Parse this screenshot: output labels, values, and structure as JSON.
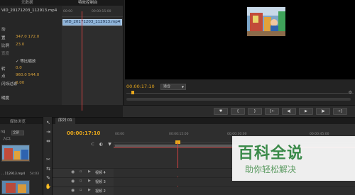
{
  "effect_controls": {
    "tab_labels": [
      "元数据",
      "特效控制台"
    ],
    "clip_name": "VID_20171203_112913.mp4",
    "properties": [
      {
        "label": "动",
        "value": ""
      },
      {
        "label": "置",
        "value": "347.0    172.0"
      },
      {
        "label": "比例",
        "value": "23.0"
      },
      {
        "label": "宽度",
        "value": ""
      },
      {
        "label": "等比缩放",
        "value": ""
      },
      {
        "label": "转",
        "value": "0.0"
      },
      {
        "label": "点",
        "value": "960.0    544.0"
      },
      {
        "label": "闪烁过滤",
        "value": "0.00"
      },
      {
        "label": "明度",
        "value": ""
      }
    ],
    "ruler_times": [
      "00:00",
      "00:00:15:00"
    ],
    "timeline_clip": "VID_20171203_112913.mp4"
  },
  "program_monitor": {
    "timecode": "00:00:17:10",
    "fit": "适合",
    "transport_buttons": [
      "♥",
      "{",
      "}",
      "{←",
      "◀|",
      "▶",
      "|▶",
      "→}"
    ]
  },
  "project_panel": {
    "tab": "媒体浏览",
    "filter_left": "roj",
    "filter_label": "入口:",
    "filter_value": "全部",
    "items": [
      {
        "name": "…112913.mp4",
        "duration": "54:03"
      },
      {
        "name": "",
        "duration": ""
      }
    ]
  },
  "tools": [
    "↖",
    "⇥",
    "⇹",
    "✂",
    "⇆",
    "✎",
    "✋",
    "🔍"
  ],
  "sequence": {
    "tab": "序列 01",
    "timecode": "00:00:17:10",
    "ruler": [
      "00:00",
      "00:00:15:00",
      "00:00:30:00",
      "00:00:45:00"
    ],
    "tracks": [
      "视频 4",
      "视频 3",
      "视频 2"
    ]
  },
  "watermark": {
    "title": "百科全说",
    "subtitle": "助你轻松解决"
  },
  "colors": {
    "accent_timecode": "#e8a81c",
    "playhead": "#d44242",
    "clip": "#8fb4d9",
    "watermark_green": "#3a8a49"
  }
}
